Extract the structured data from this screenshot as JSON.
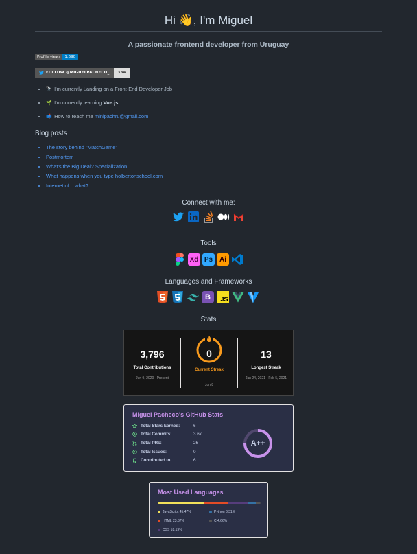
{
  "header": {
    "greeting": "Hi",
    "wave_emoji": "👋",
    "name_text": ", I'm Miguel",
    "subtitle": "A passionate frontend developer from Uruguay"
  },
  "badges": {
    "views_label": "Profile views",
    "views_count": "1,690",
    "follow_label": "FOLLOW @MIGUELPACHECO_",
    "follow_count": "384"
  },
  "info": [
    {
      "emoji": "🔭",
      "text": "I'm currently Landing on a Front-End Developer Job",
      "bold": ""
    },
    {
      "emoji": "🌱",
      "text": "I'm currently learning ",
      "bold": "Vue.js"
    },
    {
      "emoji": "📫",
      "text": "How to reach me ",
      "link": "minipachru@gmail.com"
    }
  ],
  "blog": {
    "heading": "Blog posts",
    "posts": [
      "The story behind \"MatchGame\"",
      "Postmortem",
      "What's the Big Deal? Specialization",
      "What happens when you type holbertonschool.com",
      "Internet of... what?"
    ]
  },
  "sections": {
    "connect": "Connect with me:",
    "tools": "Tools",
    "languages": "Languages and Frameworks",
    "stats": "Stats"
  },
  "connect_icons": [
    "twitter-icon",
    "linkedin-icon",
    "stackoverflow-icon",
    "medium-icon",
    "gmail-icon"
  ],
  "tool_icons": [
    "figma-icon",
    "xd-icon",
    "photoshop-icon",
    "illustrator-icon",
    "vscode-icon"
  ],
  "tool_labels": {
    "xd": "Xd",
    "ps": "Ps",
    "ai": "Ai"
  },
  "lang_icons": [
    "html5-icon",
    "css3-icon",
    "tailwind-icon",
    "bootstrap-icon",
    "javascript-icon",
    "vue-icon",
    "vuetify-icon"
  ],
  "lang_labels": {
    "bootstrap": "B",
    "js": "JS"
  },
  "streak": {
    "total_value": "3,796",
    "total_label": "Total Contributions",
    "total_range": "Jun 9, 2020 - Present",
    "current_value": "0",
    "current_label": "Current Streak",
    "current_date": "Jun 8",
    "longest_value": "13",
    "longest_label": "Longest Streak",
    "longest_range": "Jan 24, 2021 - Feb 5, 2021"
  },
  "github_stats": {
    "title": "Miguel Pacheco's GitHub Stats",
    "rows": [
      {
        "label": "Total Stars Earned:",
        "value": "6"
      },
      {
        "label": "Total Commits:",
        "value": "3.6k"
      },
      {
        "label": "Total PRs:",
        "value": "26"
      },
      {
        "label": "Total Issues:",
        "value": "0"
      },
      {
        "label": "Contributed to:",
        "value": "6"
      }
    ],
    "rank": "A++"
  },
  "top_langs": {
    "title": "Most Used Languages",
    "items": [
      {
        "name": "JavaScript",
        "percent": "45.47%",
        "value": 45.47,
        "color": "#f1e05a"
      },
      {
        "name": "Python",
        "percent": "8.31%",
        "value": 8.31,
        "color": "#3572a5"
      },
      {
        "name": "HTML",
        "percent": "23.37%",
        "value": 23.37,
        "color": "#e34c26"
      },
      {
        "name": "C",
        "percent": "4.66%",
        "value": 4.66,
        "color": "#555555"
      },
      {
        "name": "CSS",
        "percent": "18.19%",
        "value": 18.19,
        "color": "#563d7c"
      }
    ]
  },
  "colors": {
    "background": "#22272e",
    "link": "#539bf5",
    "card_title": "#c792ea",
    "streak_accent": "#f89a1d"
  }
}
